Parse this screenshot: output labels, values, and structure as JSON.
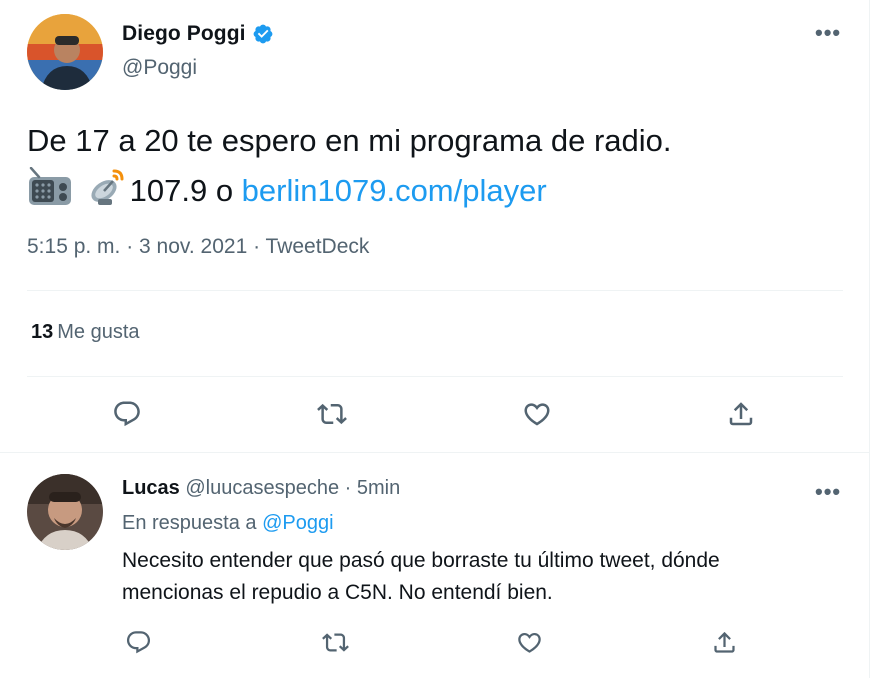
{
  "tweet": {
    "author_name": "Diego Poggi",
    "author_handle": "@Poggi",
    "verified": true,
    "text_line1": "De 17 a 20 te espero en mi programa de radio.",
    "text_line2_prefix": "107.9 o ",
    "link": "berlin1079.com/player",
    "emojis": [
      "radio-icon",
      "satellite-antenna-icon"
    ],
    "timestamp": "5:15 p. m. · 3 nov. 2021 · TweetDeck",
    "likes_count": "13",
    "likes_label": "Me gusta"
  },
  "reply": {
    "author_name": "Lucas",
    "author_handle": "@luucasespeche",
    "time_sep": " · ",
    "time": "5min",
    "replying_prefix": "En respuesta a ",
    "replying_handle": "@Poggi",
    "text_line1": "Necesito entender que pasó que borraste tu último tweet, dónde",
    "text_line2": "mencionas el repudio a C5N. No entendí bien."
  },
  "icons": {
    "reply": "reply-icon",
    "retweet": "retweet-icon",
    "like": "heart-icon",
    "share": "share-icon",
    "more": "more-icon"
  },
  "colors": {
    "accent": "#1d9bf0",
    "text": "#0f1419",
    "secondary": "#536471",
    "divider": "#eff3f4"
  }
}
